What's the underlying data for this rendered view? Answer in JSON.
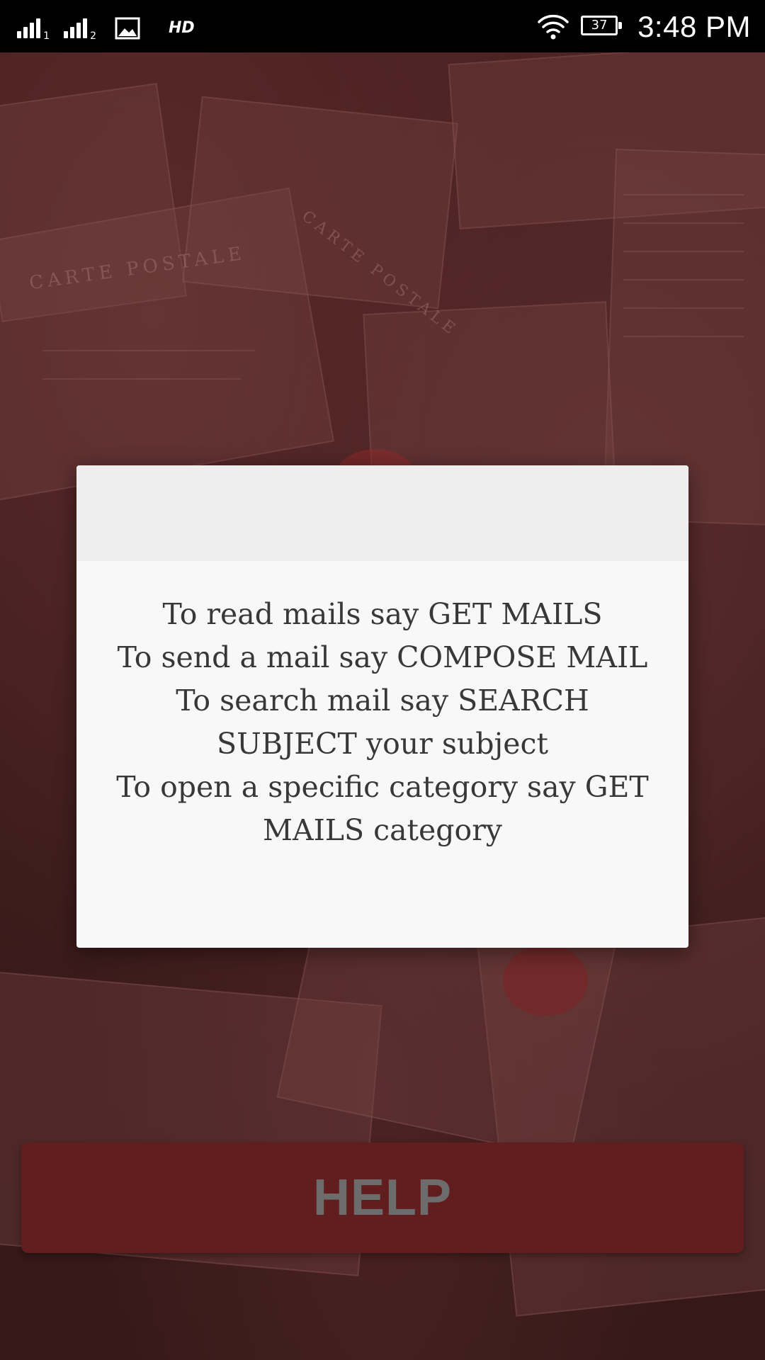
{
  "status_bar": {
    "sim1_label": "1",
    "sim2_label": "2",
    "network_label": "HD",
    "battery_level": "37",
    "time": "3:48 PM"
  },
  "dialog": {
    "lines": [
      "To read mails say GET MAILS",
      " To send a mail say COMPOSE MAIL",
      " To search mail say SEARCH SUBJECT your subject",
      " To open a specific category say GET MAILS category"
    ]
  },
  "help_button": {
    "label": "HELP"
  },
  "background_art": {
    "postcard_heading_1": "CARTE POSTALE",
    "postcard_heading_2": "CARTE POSTALE"
  },
  "colors": {
    "status_bar": "#000000",
    "background": "#3e1c1c",
    "dialog_body": "#f8f8f8",
    "dialog_header": "#eeeeee",
    "dialog_text": "#383838",
    "help_button": "#621d1f",
    "help_text": "#6c6c6c"
  },
  "icons": [
    "signal-sim1-icon",
    "signal-sim2-icon",
    "gallery-notification-icon",
    "wifi-icon",
    "battery-icon"
  ]
}
